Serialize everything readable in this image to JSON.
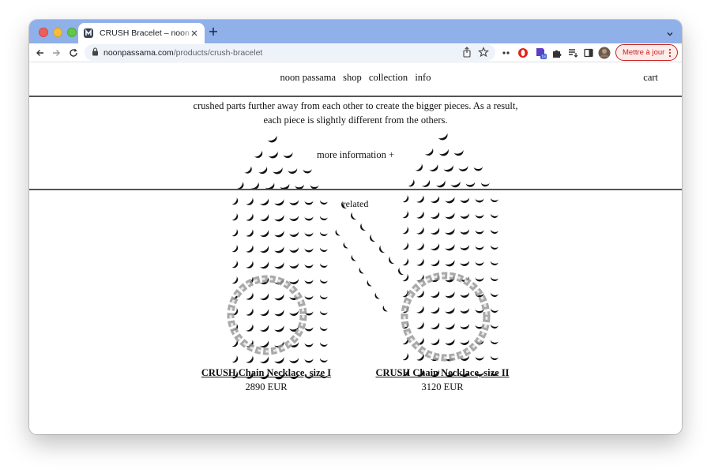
{
  "browser": {
    "tab_title": "CRUSH Bracelet – noon passama",
    "url_domain": "noonpassama.com",
    "url_path": "/products/crush-bracelet",
    "update_label": "Mettre à jour",
    "extension_badge": "18"
  },
  "site": {
    "nav": [
      "noon passama",
      "shop",
      "collection",
      "info"
    ],
    "cart_label": "cart"
  },
  "product": {
    "description_lines": [
      "crushed parts further away from each other to create the bigger pieces. As a result,",
      "each piece is slightly different from the others."
    ],
    "more_info_label": "more information +",
    "related_label": "related"
  },
  "related_products": [
    {
      "title": "CRUSH Chain Necklace, size I",
      "price": "2890 EUR"
    },
    {
      "title": "CRUSH Chain Necklace, size II",
      "price": "3120 EUR"
    }
  ],
  "colors": {
    "tab_strip": "#8fb0e8",
    "update_red": "#c5221f",
    "text": "#111111"
  }
}
